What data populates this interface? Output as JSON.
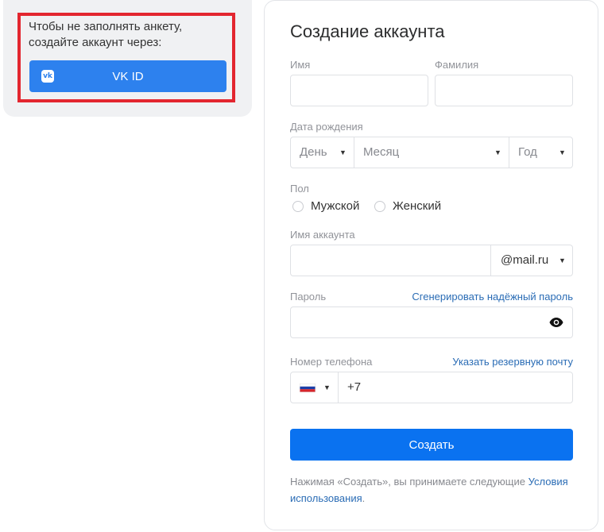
{
  "vk": {
    "prompt": "Чтобы не заполнять анкету, создайте аккаунт через:",
    "button_label": "VK ID",
    "icon_glyph": "vk",
    "icon": "vk-logo-icon"
  },
  "form": {
    "title": "Создание аккаунта",
    "first_name_label": "Имя",
    "last_name_label": "Фамилия",
    "birth_label": "Дата рождения",
    "day_placeholder": "День",
    "month_placeholder": "Месяц",
    "year_placeholder": "Год",
    "gender_label": "Пол",
    "gender_options": [
      "Мужской",
      "Женский"
    ],
    "account_label": "Имя аккаунта",
    "domain": "@mail.ru",
    "password_label": "Пароль",
    "generate_password_link": "Сгенерировать надёжный пароль",
    "phone_label": "Номер телефона",
    "backup_email_link": "Указать резервную почту",
    "phone_prefix": "+7",
    "submit_label": "Создать",
    "terms_text": "Нажимая «Создать», вы принимаете следующие ",
    "terms_link": "Условия использования",
    "terms_end": "."
  },
  "colors": {
    "highlight": "#e3262f",
    "vk_button": "#2d81ee",
    "submit_button": "#0a72f0",
    "link": "#2a6cb5"
  }
}
